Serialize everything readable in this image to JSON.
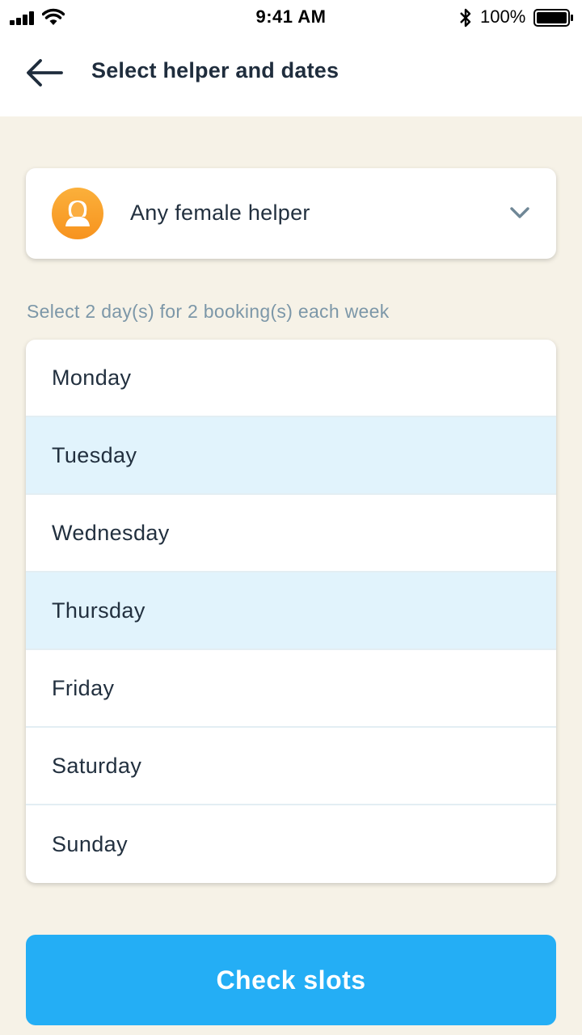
{
  "status_bar": {
    "time": "9:41 AM",
    "battery": "100%"
  },
  "header": {
    "title": "Select helper and dates",
    "back_icon": "arrow-left-icon"
  },
  "helper_select": {
    "value": "Any female helper",
    "avatar_icon": "female-avatar-icon",
    "chevron_icon": "chevron-down-icon"
  },
  "hint": "Select 2 day(s) for 2 booking(s) each week",
  "days": [
    {
      "label": "Monday",
      "selected": false
    },
    {
      "label": "Tuesday",
      "selected": true
    },
    {
      "label": "Wednesday",
      "selected": false
    },
    {
      "label": "Thursday",
      "selected": true
    },
    {
      "label": "Friday",
      "selected": false
    },
    {
      "label": "Saturday",
      "selected": false
    },
    {
      "label": "Sunday",
      "selected": false
    }
  ],
  "cta": {
    "label": "Check slots"
  },
  "colors": {
    "accent": "#24aef5",
    "selected_row": "#e1f3fc",
    "background": "#f6f2e7",
    "avatar": "#f7931e"
  }
}
